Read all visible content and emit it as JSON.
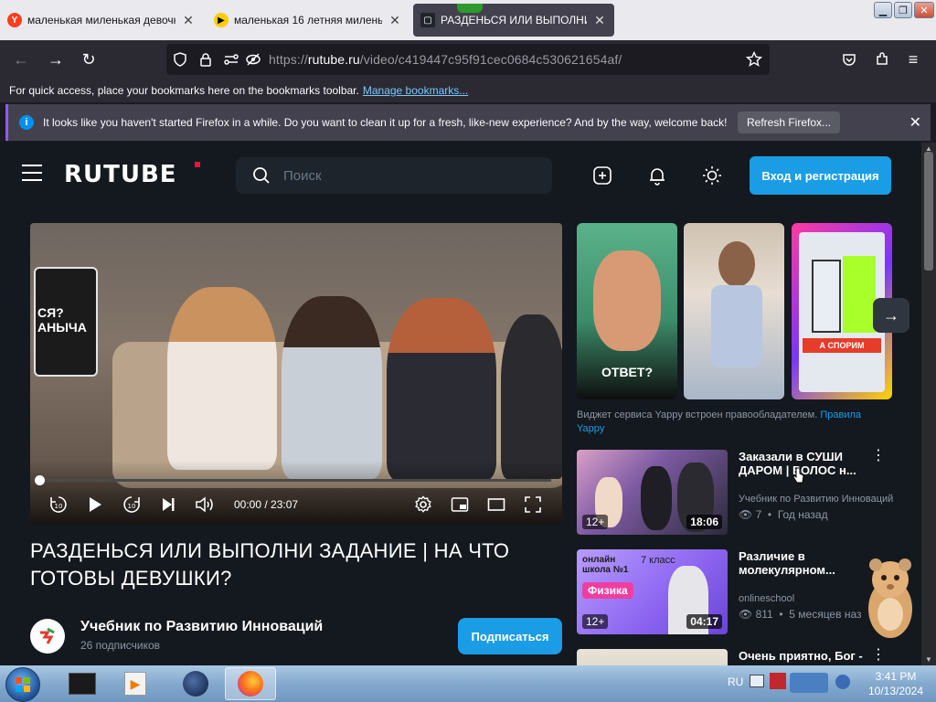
{
  "browser": {
    "tabs": [
      {
        "label": "маленькая миленькая девочк",
        "favicon": "yandex-icon",
        "active": false
      },
      {
        "label": "маленькая 16 летняя милены",
        "favicon": "play-icon",
        "active": false
      },
      {
        "label": "РАЗДЕНЬСЯ ИЛИ ВЫПОЛНИ З",
        "favicon": "rutube-icon",
        "active": true
      }
    ],
    "url_prefix": "https://",
    "url_host": "rutube.ru",
    "url_path": "/video/c419447c95f91cec0684c530621654af/",
    "bookmarks_text": "For quick access, place your bookmarks here on the bookmarks toolbar.",
    "bookmarks_link": "Manage bookmarks...",
    "notice_text": "It looks like you haven't started Firefox in a while. Do you want to clean it up for a fresh, like-new experience? And by the way, welcome back!",
    "notice_button": "Refresh Firefox..."
  },
  "site": {
    "logo": "RUTUBE",
    "search_placeholder": "Поиск",
    "login_button": "Вход и регистрация"
  },
  "video": {
    "poster_text": "СЯ?\nАНЫЧА",
    "time_current": "00:00",
    "time_total": "23:07",
    "title": "РАЗДЕНЬСЯ ИЛИ ВЫПОЛНИ ЗАДАНИЕ | НА ЧТО ГОТОВЫ ДЕВУШКИ?",
    "channel_name": "Учебник по Развитию Инноваций",
    "channel_subs": "26 подписчиков",
    "subscribe_button": "Подписаться"
  },
  "yappy": {
    "shorts": [
      {
        "caption": "ОТВЕТ?"
      },
      {
        "caption": ""
      },
      {
        "caption": "А СПОРИМ"
      }
    ],
    "note_text": "Виджет сервиса Yappy встроен правообладателем.",
    "note_link": "Правила Yappy"
  },
  "recommendations": [
    {
      "title": "Заказали в СУШИ ДАРОМ | ВОЛОС н...",
      "channel": "Учебник по Развитию Инноваций",
      "views": "7",
      "ago": "Год назад",
      "age": "12+",
      "duration": "18:06"
    },
    {
      "title": "Различие в молекулярном...",
      "channel": "onlineschool",
      "views": "811",
      "ago": "5 месяцев наз",
      "age": "12+",
      "duration": "04:17",
      "thumb_text": "онлайн школа №1",
      "thumb_badge": "Физика",
      "thumb_grade": "7 класс"
    },
    {
      "title": "Очень приятно, Бог -",
      "channel": "",
      "views": "",
      "ago": "",
      "age": "",
      "duration": ""
    }
  ],
  "taskbar": {
    "lang": "RU",
    "time": "3:41 PM",
    "date": "10/13/2024"
  },
  "colors": {
    "accent": "#1a9de5",
    "page_bg": "#14191f",
    "logo_dot": "#ed143b"
  }
}
